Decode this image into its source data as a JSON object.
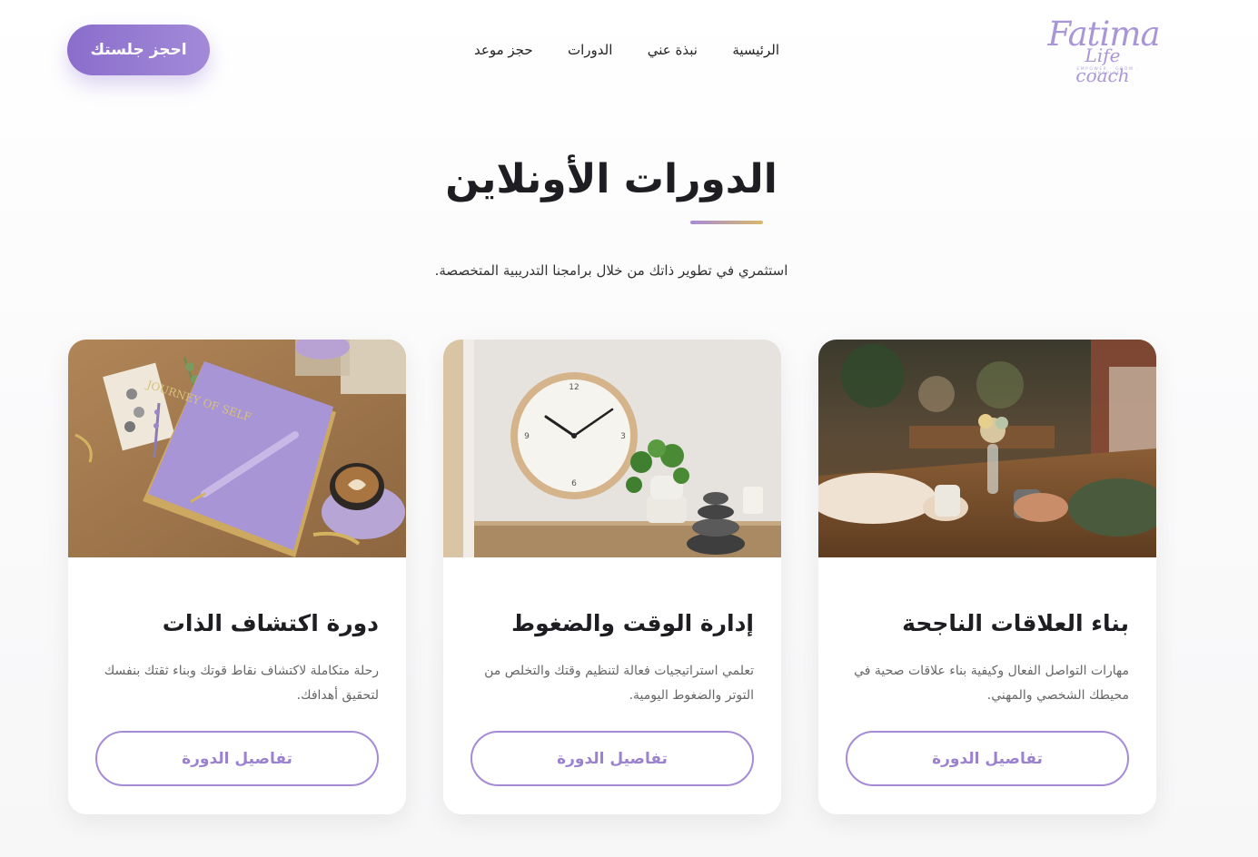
{
  "logo": {
    "main": "Fatima",
    "sub": "Life coach",
    "tagline": "EMPOWER · GROW · INSPIRE"
  },
  "nav": {
    "items": [
      {
        "label": "الرئيسية"
      },
      {
        "label": "نبذة عني"
      },
      {
        "label": "الدورات"
      },
      {
        "label": "حجز موعد"
      }
    ]
  },
  "header": {
    "book_button": "احجز جلستك"
  },
  "section": {
    "title": "الدورات الأونلاين",
    "subtitle": "استثمري في تطوير ذاتك من خلال برامجنا التدريبية المتخصصة."
  },
  "cards": [
    {
      "title": "بناء العلاقات الناجحة",
      "description": "مهارات التواصل الفعال وكيفية بناء علاقات صحية في محيطك الشخصي والمهني.",
      "button": "تفاصيل الدورة",
      "image_icon": "coffee-meeting-image"
    },
    {
      "title": "إدارة الوقت والضغوط",
      "description": "تعلمي استراتيجيات فعالة لتنظيم وقتك والتخلص من التوتر والضغوط اليومية.",
      "button": "تفاصيل الدورة",
      "image_icon": "wall-clock-image"
    },
    {
      "title": "دورة اكتشاف الذات",
      "description": "رحلة متكاملة لاكتشاف نقاط قوتك وبناء ثقتك بنفسك لتحقيق أهدافك.",
      "button": "تفاصيل الدورة",
      "image_icon": "journal-coffee-image",
      "image_text": "JOURNEY OF SELF"
    }
  ],
  "colors": {
    "accent": "#9b82cf",
    "accent_dark": "#8a6dcc",
    "gold": "#d9b86a",
    "text": "#1d1d22"
  }
}
